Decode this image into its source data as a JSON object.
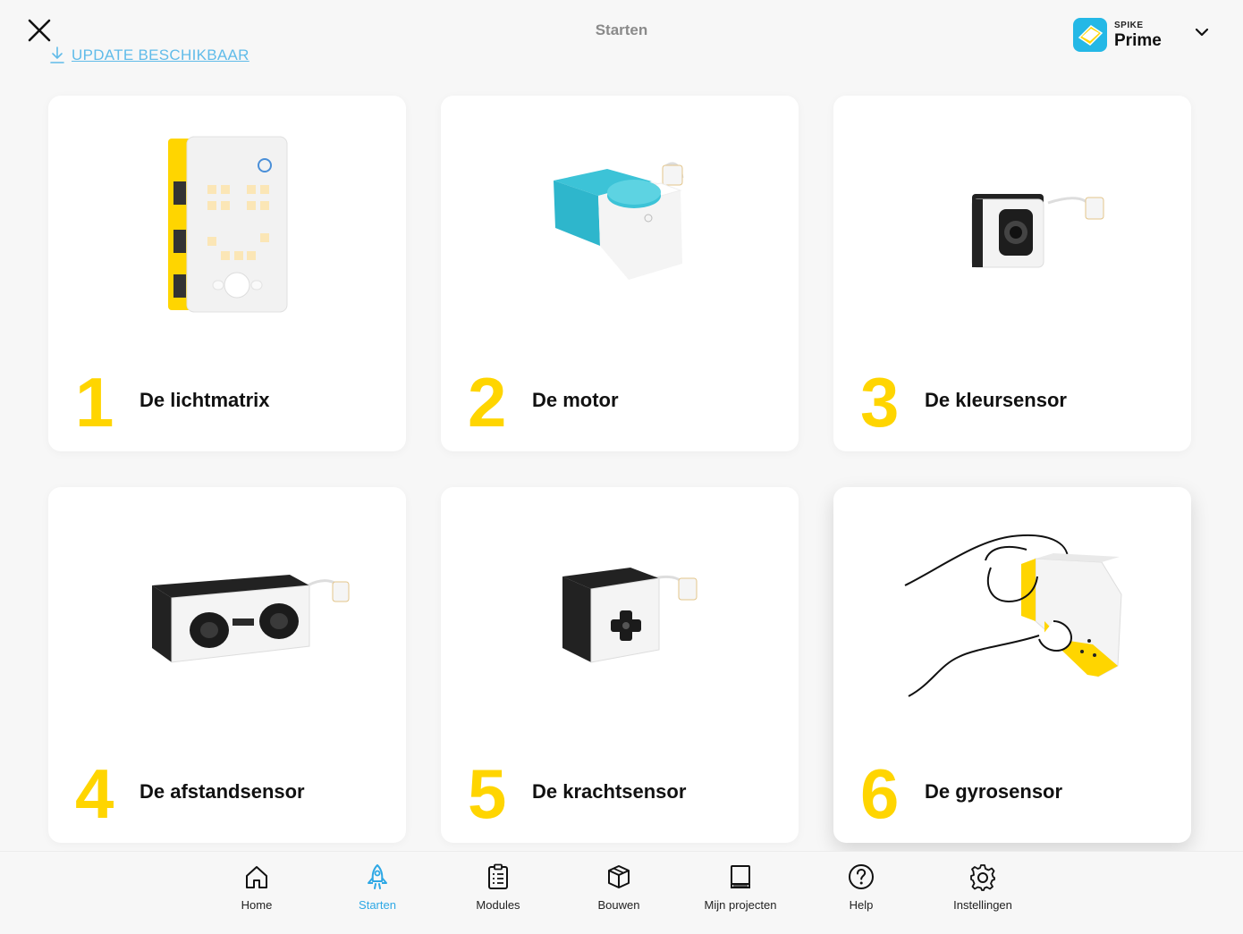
{
  "header": {
    "title": "Starten",
    "update_label": "UPDATE BESCHIKBAAR",
    "brand_small": "SPIKE",
    "brand_big": "Prime"
  },
  "cards": [
    {
      "number": "1",
      "label": "De lichtmatrix",
      "icon": "hub-image"
    },
    {
      "number": "2",
      "label": "De motor",
      "icon": "motor-image"
    },
    {
      "number": "3",
      "label": "De kleursensor",
      "icon": "color-sensor-image"
    },
    {
      "number": "4",
      "label": "De afstandsensor",
      "icon": "distance-sensor-image"
    },
    {
      "number": "5",
      "label": "De krachtsensor",
      "icon": "force-sensor-image"
    },
    {
      "number": "6",
      "label": "De gyrosensor",
      "icon": "gyro-hand-image"
    }
  ],
  "nav": {
    "items": [
      {
        "label": "Home",
        "icon": "home-icon"
      },
      {
        "label": "Starten",
        "icon": "rocket-icon",
        "active": true
      },
      {
        "label": "Modules",
        "icon": "clipboard-icon"
      },
      {
        "label": "Bouwen",
        "icon": "box-icon"
      },
      {
        "label": "Mijn projecten",
        "icon": "book-icon"
      },
      {
        "label": "Help",
        "icon": "help-icon"
      },
      {
        "label": "Instellingen",
        "icon": "gear-icon"
      }
    ]
  },
  "colors": {
    "accent": "#2ea8e5",
    "number_yellow": "#ffd500",
    "background": "#f7f7f7"
  }
}
